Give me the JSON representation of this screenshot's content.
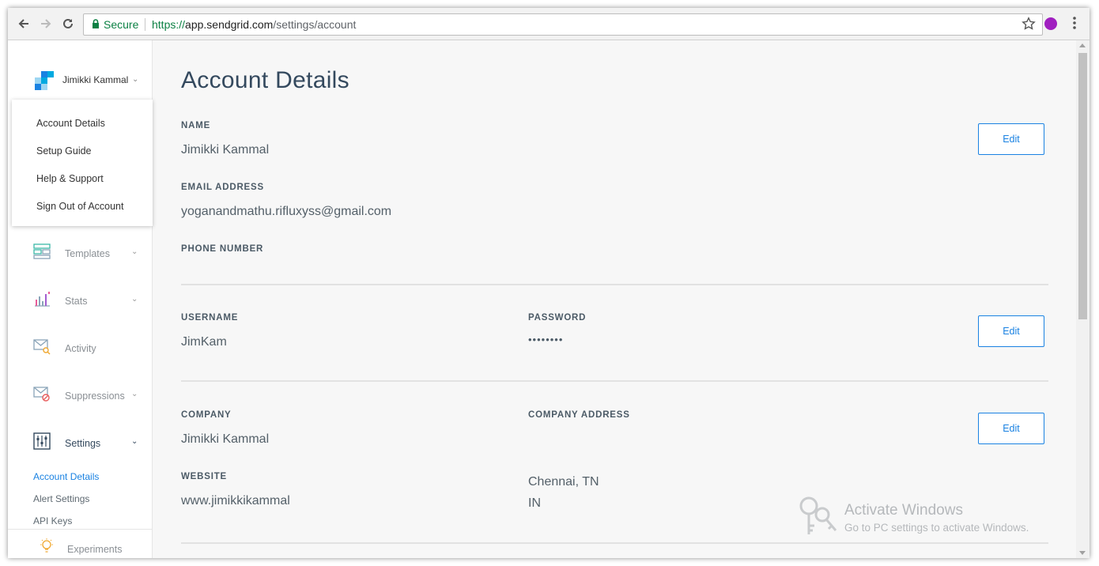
{
  "browser": {
    "secure_label": "Secure",
    "url_scheme": "https://",
    "url_host": "app.sendgrid.com",
    "url_path": "/settings/account"
  },
  "sidebar": {
    "user_name": "Jimikki Kammal",
    "user_menu": [
      {
        "label": "Account Details"
      },
      {
        "label": "Setup Guide"
      },
      {
        "label": "Help & Support"
      },
      {
        "label": "Sign Out of Account"
      }
    ],
    "nav": [
      {
        "label": "Templates",
        "icon": "templates-icon"
      },
      {
        "label": "Stats",
        "icon": "stats-icon"
      },
      {
        "label": "Activity",
        "icon": "activity-icon"
      },
      {
        "label": "Suppressions",
        "icon": "suppressions-icon"
      },
      {
        "label": "Settings",
        "icon": "settings-icon"
      }
    ],
    "settings_sub": [
      {
        "label": "Account Details"
      },
      {
        "label": "Alert Settings"
      },
      {
        "label": "API Keys"
      }
    ],
    "experiments_label": "Experiments",
    "accent_color": "#1a82e2"
  },
  "main": {
    "title": "Account Details",
    "edit_label": "Edit",
    "name_label": "NAME",
    "name_value": "Jimikki Kammal",
    "email_label": "EMAIL ADDRESS",
    "email_value": "yoganandmathu.rifluxyss@gmail.com",
    "phone_label": "PHONE NUMBER",
    "username_label": "USERNAME",
    "username_value": "JimKam",
    "password_label": "PASSWORD",
    "password_value": "••••••••",
    "company_label": "COMPANY",
    "company_value": "Jimikki Kammal",
    "company_address_label": "COMPANY ADDRESS",
    "company_address_line1": "Chennai, TN",
    "company_address_line2": "IN",
    "website_label": "WEBSITE",
    "website_value": "www.jimikkikammal"
  },
  "watermark": {
    "title": "Activate Windows",
    "subtitle": "Go to PC settings to activate Windows."
  }
}
